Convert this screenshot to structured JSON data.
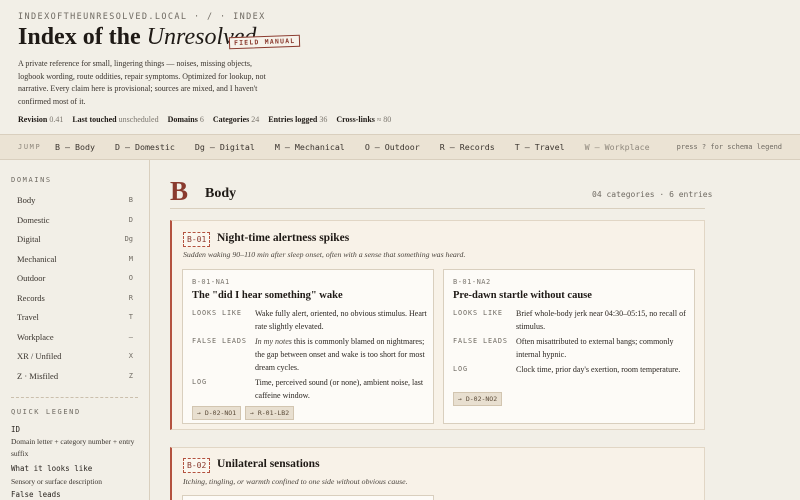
{
  "header": {
    "breadcrumb": "INDEXOFTHEUNRESOLVED.LOCAL · / · INDEX",
    "title_main": "Index of the",
    "title_italic": "Unresolved",
    "stamp": "FIELD MANUAL",
    "intro": "A private reference for small, lingering things — noises, missing objects, logbook wording, route oddities, repair symptoms. Optimized for lookup, not narrative. Every claim here is provisional; sources are mixed, and I haven't confirmed most of it.",
    "stats": [
      {
        "label": "Revision",
        "value": "0.41"
      },
      {
        "label": "Last touched",
        "value": "unscheduled"
      },
      {
        "label": "Domains",
        "value": "6"
      },
      {
        "label": "Categories",
        "value": "24"
      },
      {
        "label": "Entries logged",
        "value": "36"
      },
      {
        "label": "Cross-links",
        "value": "≈ 80"
      }
    ]
  },
  "jumpbar": {
    "label": "JUMP",
    "links": [
      "B — Body",
      "D — Domestic",
      "Dg — Digital",
      "M — Mechanical",
      "O — Outdoor",
      "R — Records",
      "T — Travel",
      "W — Workplace"
    ],
    "hint": "press ? for schema legend"
  },
  "sidebar": {
    "domains_heading": "DOMAINS",
    "domains": [
      {
        "name": "Body",
        "code": "B"
      },
      {
        "name": "Domestic",
        "code": "D"
      },
      {
        "name": "Digital",
        "code": "Dg"
      },
      {
        "name": "Mechanical",
        "code": "M"
      },
      {
        "name": "Outdoor",
        "code": "O"
      },
      {
        "name": "Records",
        "code": "R"
      },
      {
        "name": "Travel",
        "code": "T"
      },
      {
        "name": "Workplace",
        "code": "—"
      },
      {
        "name": "XR / Unfiled",
        "code": "X"
      },
      {
        "name": "Z · Misfiled",
        "code": "Z"
      }
    ],
    "legend_heading": "QUICK LEGEND",
    "legend": [
      {
        "term": "ID",
        "desc": "Domain letter + category number + entry suffix"
      },
      {
        "term": "What it looks like",
        "desc": "Sensory or surface description"
      },
      {
        "term": "False leads",
        "desc": ""
      }
    ]
  },
  "section": {
    "letter": "B",
    "name": "Body",
    "meta": "04 categories · 6 entries",
    "categories": [
      {
        "id": "B-01",
        "title": "Night-time alertness spikes",
        "subtitle": "Sudden waking 90–110 min after sleep onset, often with a sense that something was heard.",
        "entries": [
          {
            "id": "B-01-NA1",
            "title": "The \"did I hear something\" wake",
            "looks_like_label": "LOOKS LIKE",
            "looks_like": "Wake fully alert, oriented, no obvious stimulus. Heart rate slightly elevated.",
            "false_leads_label": "FALSE LEADS",
            "false_leads_em": "In my notes",
            "false_leads": " this is commonly blamed on nightmares; the gap between onset and wake is too short for most dream cycles.",
            "log_label": "LOG",
            "log": "Time, perceived sound (or none), ambient noise, last caffeine window.",
            "xrefs": [
              "→ D-02-NO1",
              "→ R-01-LB2"
            ]
          },
          {
            "id": "B-01-NA2",
            "title": "Pre-dawn startle without cause",
            "looks_like_label": "LOOKS LIKE",
            "looks_like": "Brief whole-body jerk near 04:30–05:15, no recall of stimulus.",
            "false_leads_label": "FALSE LEADS",
            "false_leads": "Often misattributed to external bangs; commonly internal hypnic.",
            "log_label": "LOG",
            "log": "Clock time, prior day's exertion, room temperature.",
            "xrefs": [
              "→ D-02-NO2"
            ]
          }
        ]
      },
      {
        "id": "B-02",
        "title": "Unilateral sensations",
        "subtitle": "Itching, tingling, or warmth confined to one side without obvious cause."
      }
    ]
  }
}
